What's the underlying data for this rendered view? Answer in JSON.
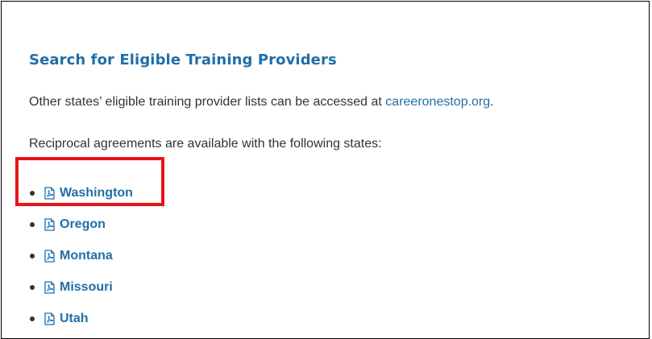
{
  "section": {
    "title": "Search for Eligible Training Providers",
    "paragraph1_text": "Other states’ eligible training provider lists can be accessed at ",
    "paragraph1_link": "careeronestop.org",
    "paragraph1_suffix": ".",
    "paragraph2_text": "Reciprocal agreements are available with the following states:"
  },
  "states": [
    {
      "label": "Washington",
      "icon": "pdf-file-icon"
    },
    {
      "label": "Oregon",
      "icon": "pdf-file-icon"
    },
    {
      "label": "Montana",
      "icon": "pdf-file-icon"
    },
    {
      "label": "Missouri",
      "icon": "pdf-file-icon"
    },
    {
      "label": "Utah",
      "icon": "pdf-file-icon"
    }
  ],
  "colors": {
    "link": "#1f6fa8",
    "highlight": "#e8141b",
    "text": "#333333"
  }
}
